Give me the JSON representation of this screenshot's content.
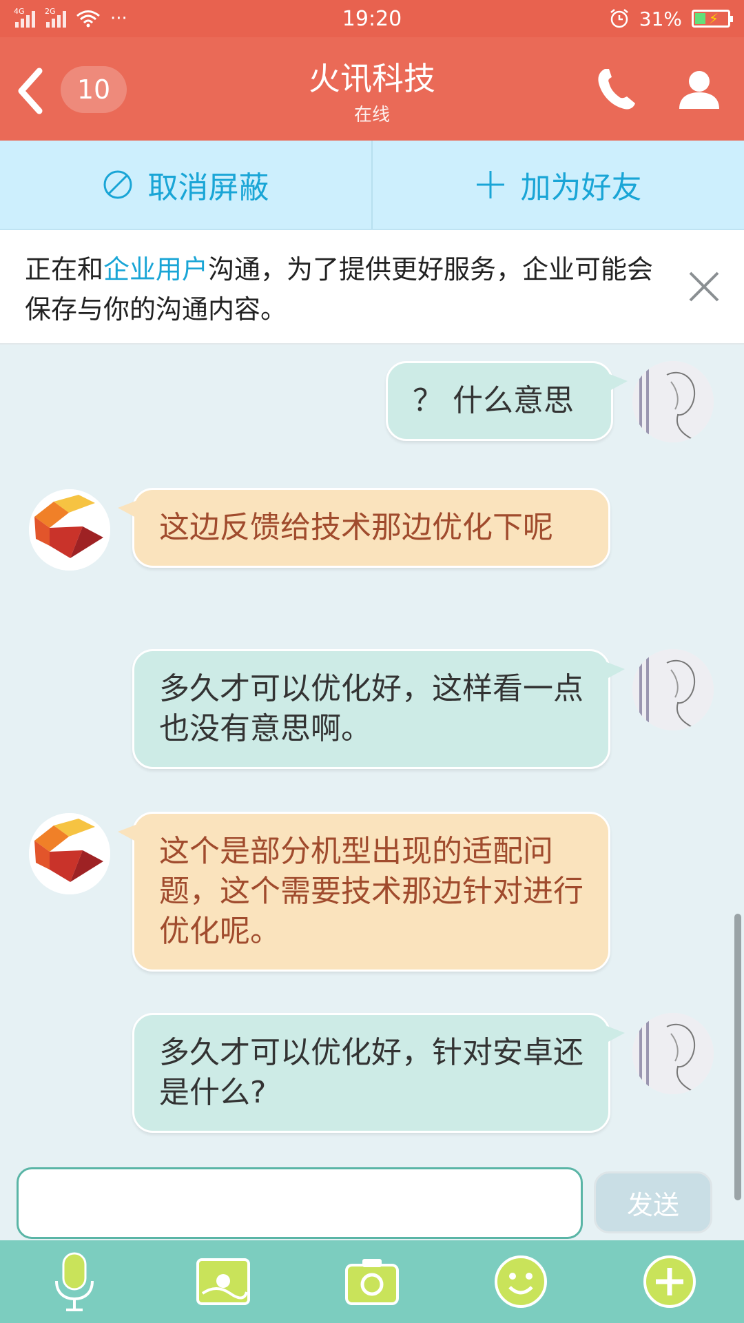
{
  "status_bar": {
    "network_1": "4G",
    "network_2": "2G",
    "more": "···",
    "time": "19:20",
    "battery": "31%"
  },
  "header": {
    "unread_count": "10",
    "title": "火讯科技",
    "subtitle": "在线"
  },
  "actions": {
    "unblock_label": "取消屏蔽",
    "add_friend_label": "加为好友"
  },
  "notice": {
    "part1": "正在和",
    "highlight": "企业用户",
    "part2": "沟通，为了提供更好服务，企业可能会保存与你的沟通内容。"
  },
  "messages": [
    {
      "sender": "me",
      "text": "？ 什么意思"
    },
    {
      "sender": "them",
      "text": "这边反馈给技术那边优化下呢"
    },
    {
      "sender": "me",
      "text": "多久才可以优化好，这样看一点也没有意思啊。"
    },
    {
      "sender": "them",
      "text": "这个是部分机型出现的适配问题，这个需要技术那边针对进行优化呢。"
    },
    {
      "sender": "me",
      "text": "多久才可以优化好，针对安卓还是什么?"
    }
  ],
  "composer": {
    "value": "",
    "send_label": "发送"
  },
  "colors": {
    "header": "#ea6a57",
    "action_bar": "#cdeffd",
    "accent_blue": "#19a5d6",
    "my_bubble": "#cdebe6",
    "their_bubble": "#fae3bd",
    "toolbar": "#7ccdbf"
  },
  "icons": [
    "back-icon",
    "phone-icon",
    "profile-icon",
    "block-icon",
    "plus-icon",
    "close-icon",
    "microphone-icon",
    "image-icon",
    "camera-icon",
    "emoji-icon",
    "more-plus-icon"
  ]
}
